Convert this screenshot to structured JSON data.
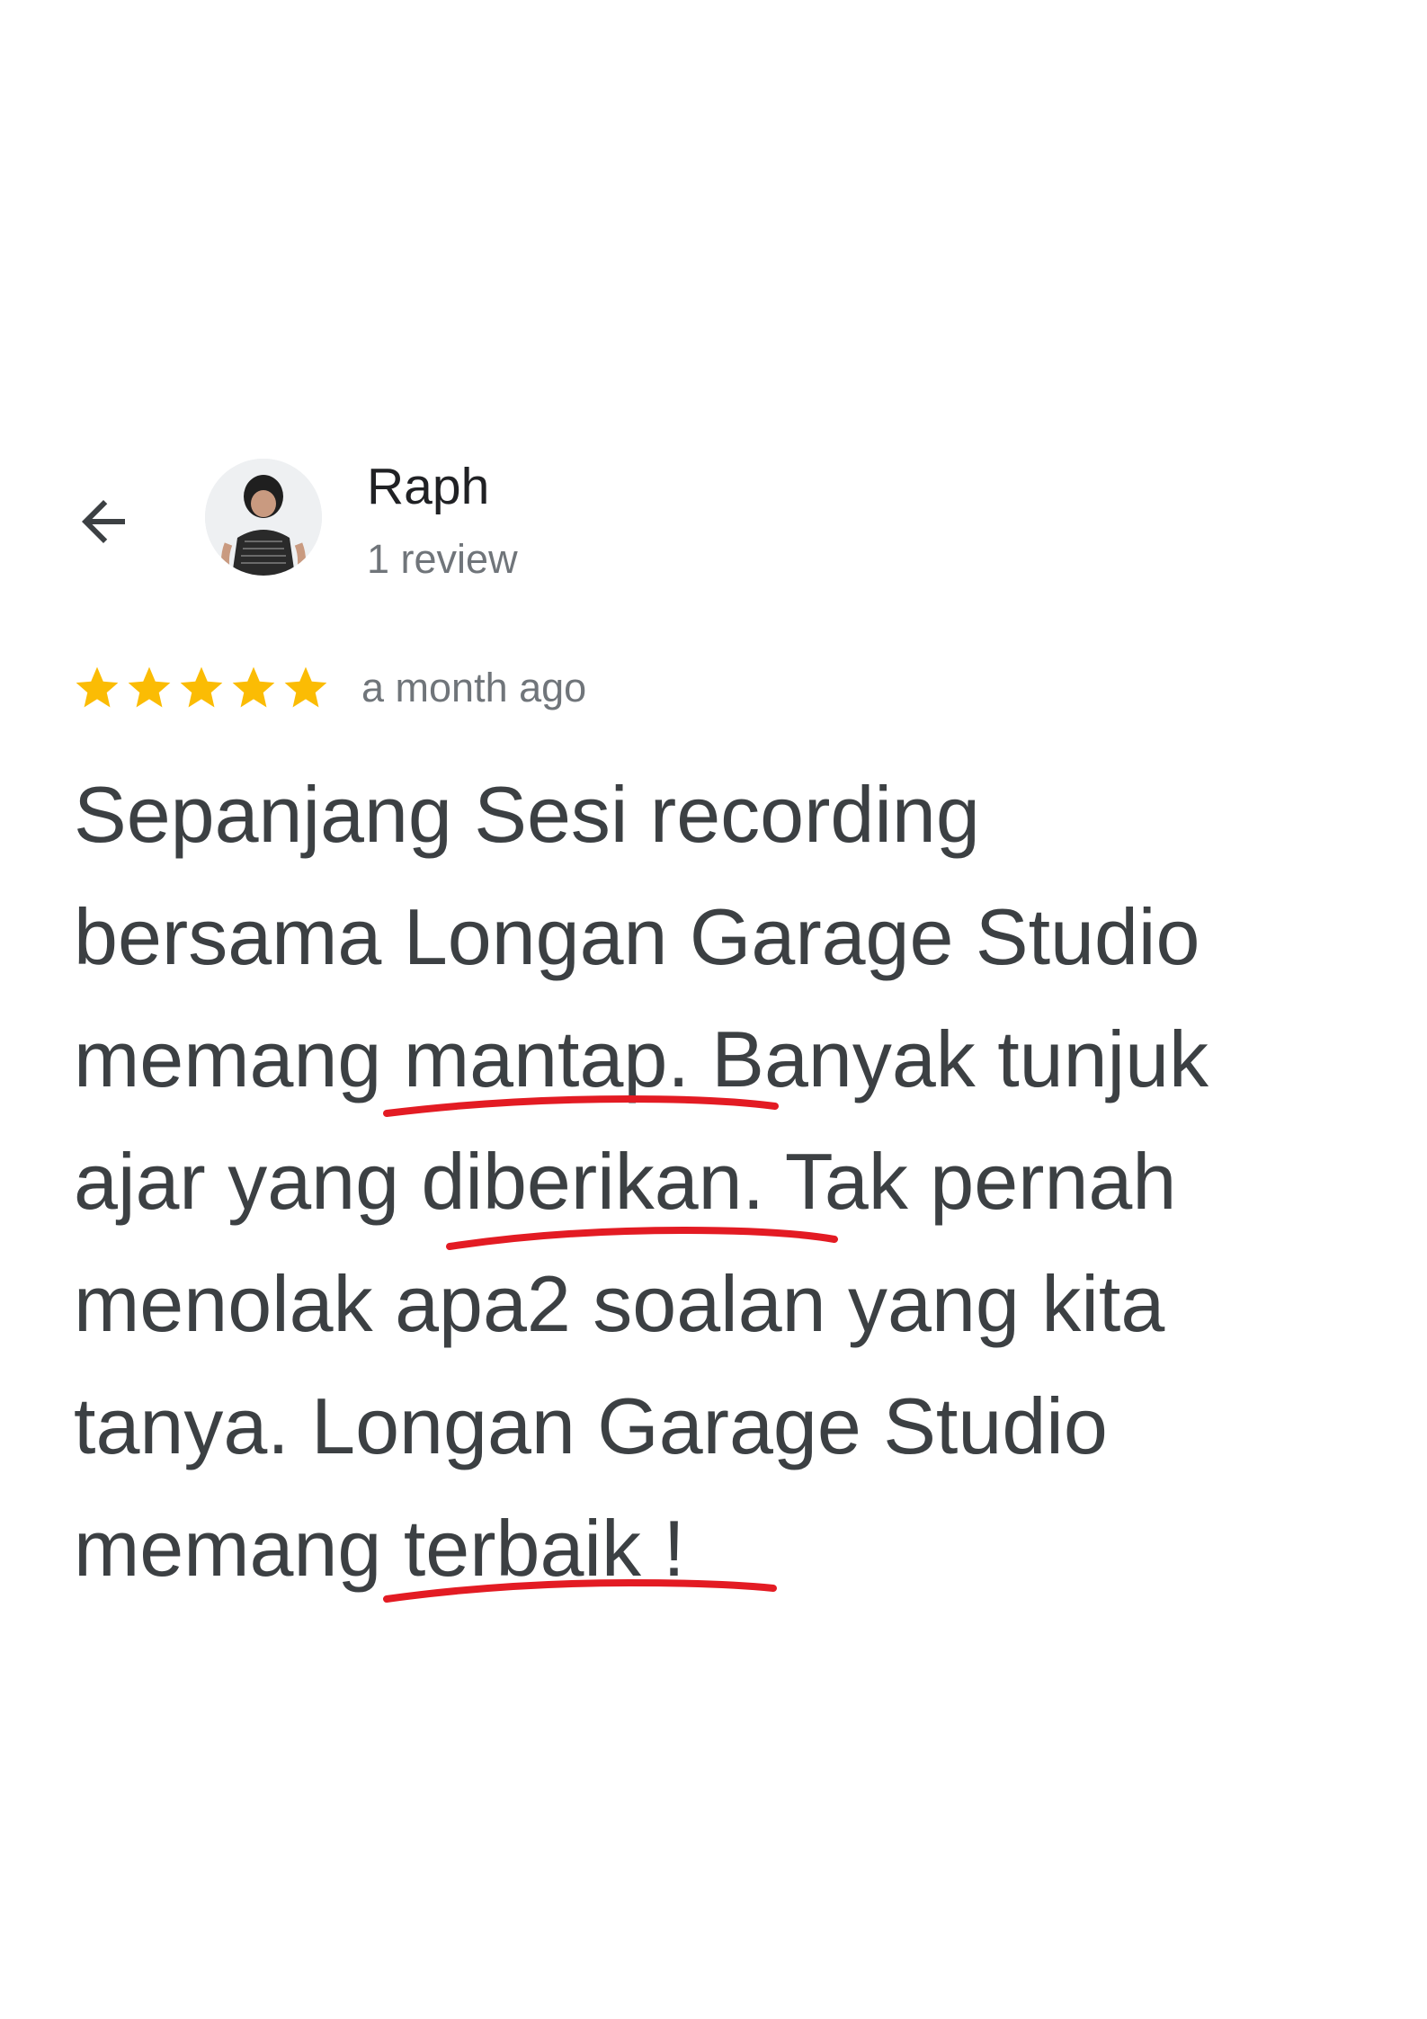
{
  "reviewer": {
    "name": "Raph",
    "review_count": "1 review"
  },
  "review": {
    "rating": 5,
    "rating_max": 5,
    "date": "a month ago",
    "text_lines": [
      "Sepanjang Sesi recording",
      "bersama Longan Garage Studio",
      "memang mantap. Banyak tunjuk",
      "ajar yang diberikan. Tak pernah",
      "menolak apa2 soalan yang kita",
      "tanya. Longan Garage Studio",
      "memang terbaik !"
    ]
  },
  "icons": {
    "back": "back-arrow-icon",
    "star": "star-icon",
    "avatar": "user-avatar"
  },
  "colors": {
    "star": "#fbbc04",
    "annotation": "#e31b23",
    "text": "#3c4043",
    "meta": "#70757a",
    "name": "#202124"
  }
}
